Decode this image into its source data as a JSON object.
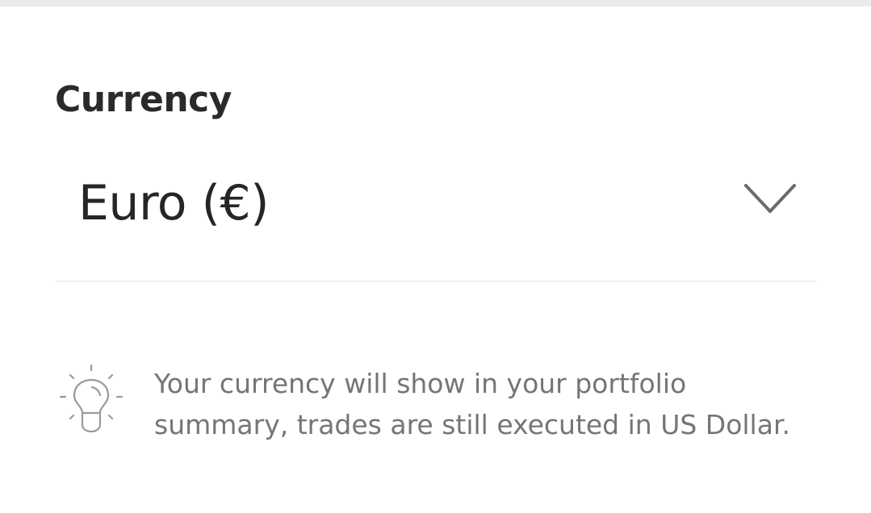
{
  "currency": {
    "title": "Currency",
    "selected_value": "Euro (€)"
  },
  "hint": {
    "icon": "lightbulb-icon",
    "text": "Your currency will show in your portfolio summary, trades are still executed in US Dollar."
  }
}
